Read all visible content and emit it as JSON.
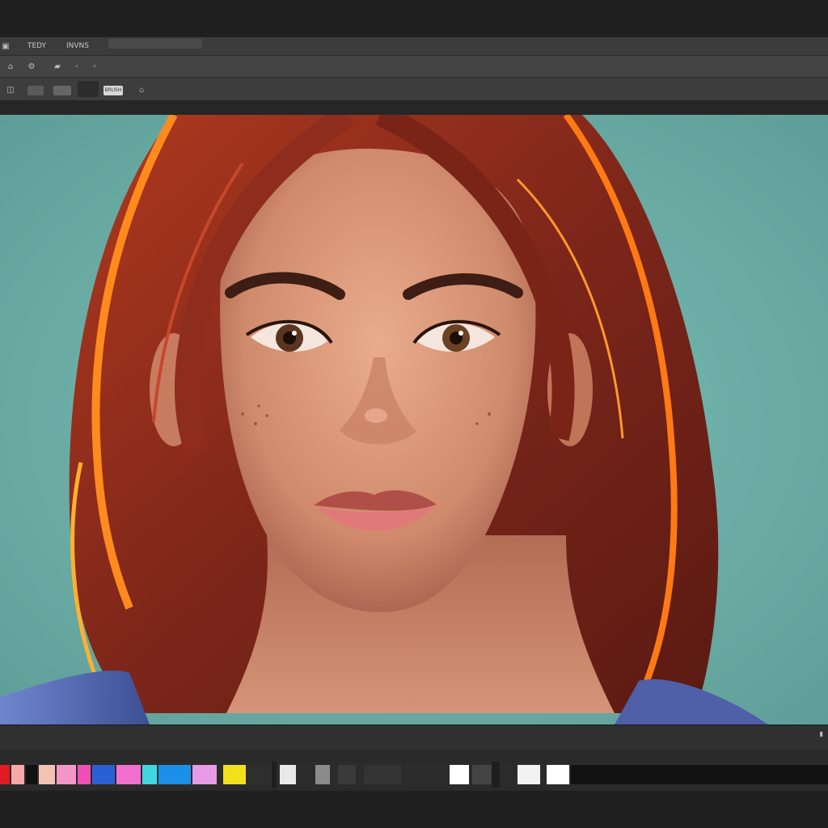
{
  "menubar": {
    "items": [
      "TEDY",
      "INVNS"
    ]
  },
  "toolbar1": {
    "icons": [
      "home-icon",
      "gear-icon",
      "folder-icon",
      "dot-icon",
      "dot-icon"
    ]
  },
  "toolbar2": {
    "badge": "BRUSH"
  },
  "bottom": {
    "corner_mark": "▮"
  },
  "palette": {
    "colors": [
      "#e31b23",
      "#f7a8a8",
      "#111111",
      "#f4c2b5",
      "#f596c8",
      "#ef4fb4",
      "#2a5fd6",
      "#f26fd0",
      "#3fd6e0",
      "#1a90e8",
      "#e79ae6",
      "#f2e01b",
      "#2e2e2e",
      "#e9e9e9",
      "#8b8b8b",
      "#3a3a3a",
      "#343434",
      "#ffffff",
      "#444444",
      "#f2f2f2",
      "#ffffff"
    ]
  },
  "colors": {
    "canvas_bg": "#6fb3ac",
    "hair": "#8a2a1c",
    "skin": "#d9977a",
    "shirt": "#5a6fb5"
  }
}
